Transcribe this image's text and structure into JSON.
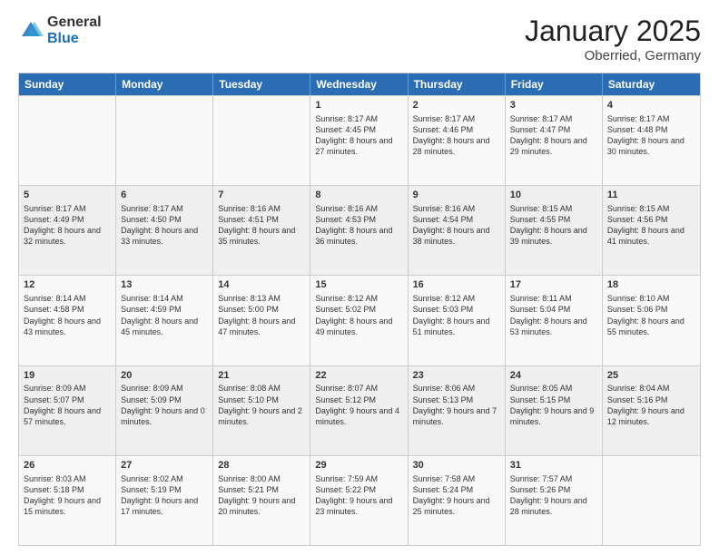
{
  "header": {
    "logo_general": "General",
    "logo_blue": "Blue",
    "month_title": "January 2025",
    "location": "Oberried, Germany"
  },
  "days_of_week": [
    "Sunday",
    "Monday",
    "Tuesday",
    "Wednesday",
    "Thursday",
    "Friday",
    "Saturday"
  ],
  "weeks": [
    [
      {
        "day": "",
        "sunrise": "",
        "sunset": "",
        "daylight": "",
        "empty": true
      },
      {
        "day": "",
        "sunrise": "",
        "sunset": "",
        "daylight": "",
        "empty": true
      },
      {
        "day": "",
        "sunrise": "",
        "sunset": "",
        "daylight": "",
        "empty": true
      },
      {
        "day": "1",
        "sunrise": "Sunrise: 8:17 AM",
        "sunset": "Sunset: 4:45 PM",
        "daylight": "Daylight: 8 hours and 27 minutes."
      },
      {
        "day": "2",
        "sunrise": "Sunrise: 8:17 AM",
        "sunset": "Sunset: 4:46 PM",
        "daylight": "Daylight: 8 hours and 28 minutes."
      },
      {
        "day": "3",
        "sunrise": "Sunrise: 8:17 AM",
        "sunset": "Sunset: 4:47 PM",
        "daylight": "Daylight: 8 hours and 29 minutes."
      },
      {
        "day": "4",
        "sunrise": "Sunrise: 8:17 AM",
        "sunset": "Sunset: 4:48 PM",
        "daylight": "Daylight: 8 hours and 30 minutes."
      }
    ],
    [
      {
        "day": "5",
        "sunrise": "Sunrise: 8:17 AM",
        "sunset": "Sunset: 4:49 PM",
        "daylight": "Daylight: 8 hours and 32 minutes."
      },
      {
        "day": "6",
        "sunrise": "Sunrise: 8:17 AM",
        "sunset": "Sunset: 4:50 PM",
        "daylight": "Daylight: 8 hours and 33 minutes."
      },
      {
        "day": "7",
        "sunrise": "Sunrise: 8:16 AM",
        "sunset": "Sunset: 4:51 PM",
        "daylight": "Daylight: 8 hours and 35 minutes."
      },
      {
        "day": "8",
        "sunrise": "Sunrise: 8:16 AM",
        "sunset": "Sunset: 4:53 PM",
        "daylight": "Daylight: 8 hours and 36 minutes."
      },
      {
        "day": "9",
        "sunrise": "Sunrise: 8:16 AM",
        "sunset": "Sunset: 4:54 PM",
        "daylight": "Daylight: 8 hours and 38 minutes."
      },
      {
        "day": "10",
        "sunrise": "Sunrise: 8:15 AM",
        "sunset": "Sunset: 4:55 PM",
        "daylight": "Daylight: 8 hours and 39 minutes."
      },
      {
        "day": "11",
        "sunrise": "Sunrise: 8:15 AM",
        "sunset": "Sunset: 4:56 PM",
        "daylight": "Daylight: 8 hours and 41 minutes."
      }
    ],
    [
      {
        "day": "12",
        "sunrise": "Sunrise: 8:14 AM",
        "sunset": "Sunset: 4:58 PM",
        "daylight": "Daylight: 8 hours and 43 minutes."
      },
      {
        "day": "13",
        "sunrise": "Sunrise: 8:14 AM",
        "sunset": "Sunset: 4:59 PM",
        "daylight": "Daylight: 8 hours and 45 minutes."
      },
      {
        "day": "14",
        "sunrise": "Sunrise: 8:13 AM",
        "sunset": "Sunset: 5:00 PM",
        "daylight": "Daylight: 8 hours and 47 minutes."
      },
      {
        "day": "15",
        "sunrise": "Sunrise: 8:12 AM",
        "sunset": "Sunset: 5:02 PM",
        "daylight": "Daylight: 8 hours and 49 minutes."
      },
      {
        "day": "16",
        "sunrise": "Sunrise: 8:12 AM",
        "sunset": "Sunset: 5:03 PM",
        "daylight": "Daylight: 8 hours and 51 minutes."
      },
      {
        "day": "17",
        "sunrise": "Sunrise: 8:11 AM",
        "sunset": "Sunset: 5:04 PM",
        "daylight": "Daylight: 8 hours and 53 minutes."
      },
      {
        "day": "18",
        "sunrise": "Sunrise: 8:10 AM",
        "sunset": "Sunset: 5:06 PM",
        "daylight": "Daylight: 8 hours and 55 minutes."
      }
    ],
    [
      {
        "day": "19",
        "sunrise": "Sunrise: 8:09 AM",
        "sunset": "Sunset: 5:07 PM",
        "daylight": "Daylight: 8 hours and 57 minutes."
      },
      {
        "day": "20",
        "sunrise": "Sunrise: 8:09 AM",
        "sunset": "Sunset: 5:09 PM",
        "daylight": "Daylight: 9 hours and 0 minutes."
      },
      {
        "day": "21",
        "sunrise": "Sunrise: 8:08 AM",
        "sunset": "Sunset: 5:10 PM",
        "daylight": "Daylight: 9 hours and 2 minutes."
      },
      {
        "day": "22",
        "sunrise": "Sunrise: 8:07 AM",
        "sunset": "Sunset: 5:12 PM",
        "daylight": "Daylight: 9 hours and 4 minutes."
      },
      {
        "day": "23",
        "sunrise": "Sunrise: 8:06 AM",
        "sunset": "Sunset: 5:13 PM",
        "daylight": "Daylight: 9 hours and 7 minutes."
      },
      {
        "day": "24",
        "sunrise": "Sunrise: 8:05 AM",
        "sunset": "Sunset: 5:15 PM",
        "daylight": "Daylight: 9 hours and 9 minutes."
      },
      {
        "day": "25",
        "sunrise": "Sunrise: 8:04 AM",
        "sunset": "Sunset: 5:16 PM",
        "daylight": "Daylight: 9 hours and 12 minutes."
      }
    ],
    [
      {
        "day": "26",
        "sunrise": "Sunrise: 8:03 AM",
        "sunset": "Sunset: 5:18 PM",
        "daylight": "Daylight: 9 hours and 15 minutes."
      },
      {
        "day": "27",
        "sunrise": "Sunrise: 8:02 AM",
        "sunset": "Sunset: 5:19 PM",
        "daylight": "Daylight: 9 hours and 17 minutes."
      },
      {
        "day": "28",
        "sunrise": "Sunrise: 8:00 AM",
        "sunset": "Sunset: 5:21 PM",
        "daylight": "Daylight: 9 hours and 20 minutes."
      },
      {
        "day": "29",
        "sunrise": "Sunrise: 7:59 AM",
        "sunset": "Sunset: 5:22 PM",
        "daylight": "Daylight: 9 hours and 23 minutes."
      },
      {
        "day": "30",
        "sunrise": "Sunrise: 7:58 AM",
        "sunset": "Sunset: 5:24 PM",
        "daylight": "Daylight: 9 hours and 25 minutes."
      },
      {
        "day": "31",
        "sunrise": "Sunrise: 7:57 AM",
        "sunset": "Sunset: 5:26 PM",
        "daylight": "Daylight: 9 hours and 28 minutes."
      },
      {
        "day": "",
        "sunrise": "",
        "sunset": "",
        "daylight": "",
        "empty": true
      }
    ]
  ]
}
